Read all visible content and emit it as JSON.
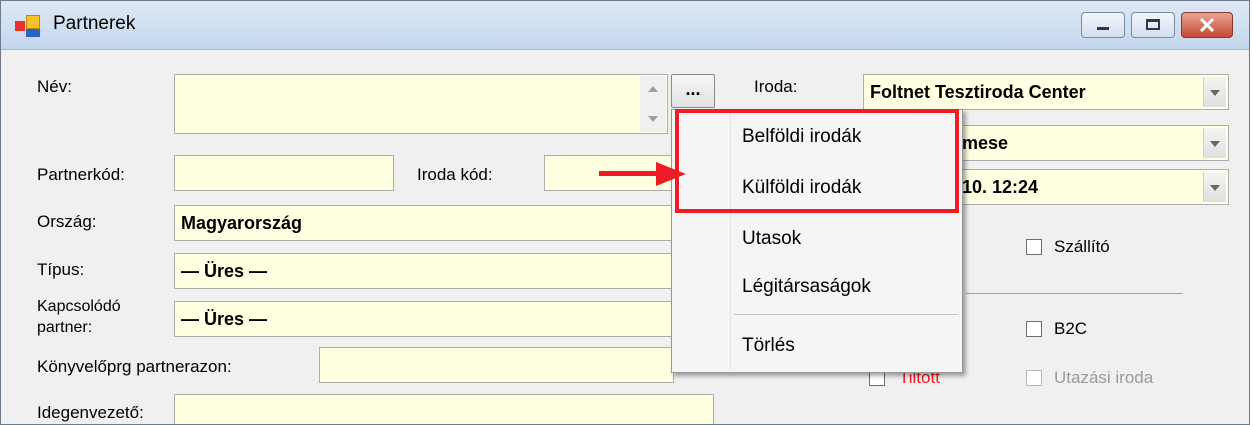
{
  "window": {
    "title": "Partnerek"
  },
  "form": {
    "nev_label": "Név:",
    "nev_value": "",
    "ellipsis_label": "...",
    "partnerkod_label": "Partnerkód:",
    "partnerkod_value": "",
    "iroda_kod_label": "Iroda kód:",
    "iroda_kod_value": "",
    "orszag_label": "Ország:",
    "orszag_value": "Magyarország",
    "tipus_label": "Típus:",
    "tipus_value": "— Üres —",
    "kapcsolodo_label_line1": "Kapcsolódó",
    "kapcsolodo_label_line2": "partner:",
    "kapcsolodo_value": "— Üres —",
    "konyvelo_label": "Könyvelőprg partnerazon:",
    "konyvelo_value": "",
    "idegenvezeto_label": "Idegenvezető:",
    "idegenvezeto_value": "",
    "iroda_label": "Iroda:",
    "iroda_value": "Foltnet Tesztiroda Center",
    "combo2_value_fragment": "mese",
    "combo3_value_fragment": "10. 12:24",
    "szallito_label": "Szállító",
    "b2c_label": "B2C",
    "tiltott_label": "Tiltott",
    "utazasi_iroda_label": "Utazási iroda"
  },
  "context_menu": {
    "items": [
      "Belföldi irodák",
      "Külföldi irodák",
      "Utasok",
      "Légitársaságok",
      "Törlés"
    ]
  },
  "colors": {
    "input_background": "#ffffe1",
    "highlight_red": "#ee1c24",
    "titlebar_top": "#dfe9f5"
  }
}
